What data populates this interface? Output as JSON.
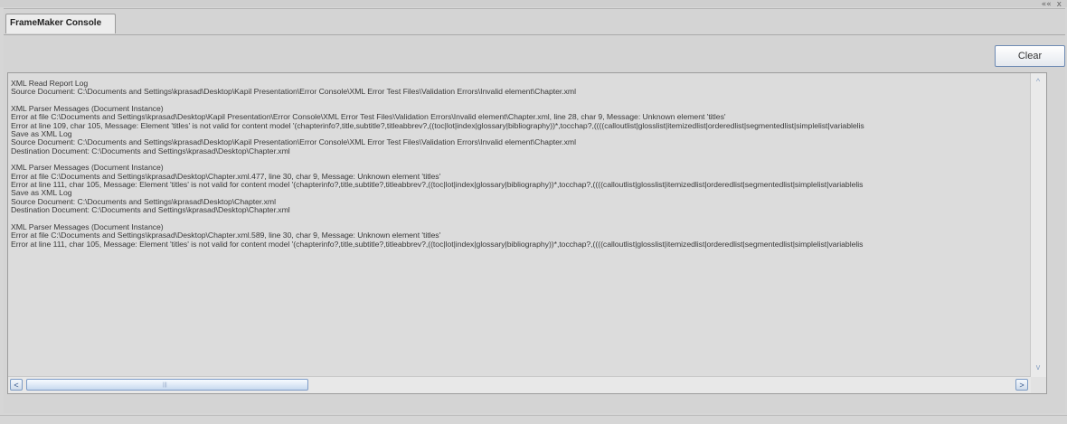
{
  "window": {
    "controls": [
      "««",
      "x"
    ]
  },
  "tabs": [
    {
      "label": "FrameMaker Console",
      "active": true
    }
  ],
  "toolbar": {
    "clear_label": "Clear"
  },
  "console": {
    "lines": [
      "XML Read Report Log",
      "Source Document: C:\\Documents and Settings\\kprasad\\Desktop\\Kapil Presentation\\Error Console\\XML Error Test Files\\Validation Errors\\Invalid element\\Chapter.xml",
      "",
      "XML Parser Messages (Document Instance)",
      "Error at file C:\\Documents and Settings\\kprasad\\Desktop\\Kapil Presentation\\Error Console\\XML Error Test Files\\Validation Errors\\Invalid element\\Chapter.xml, line 28, char 9, Message: Unknown element 'titles'",
      "Error at line 109, char 105, Message: Element 'titles' is not valid for content model '(chapterinfo?,title,subtitle?,titleabbrev?,((toc|lot|index|glossary|bibliography))*,tocchap?,((((calloutlist|glosslist|itemizedlist|orderedlist|segmentedlist|simplelist|variablelis",
      "Save as XML Log",
      "Source Document: C:\\Documents and Settings\\kprasad\\Desktop\\Kapil Presentation\\Error Console\\XML Error Test Files\\Validation Errors\\Invalid element\\Chapter.xml",
      "Destination Document: C:\\Documents and Settings\\kprasad\\Desktop\\Chapter.xml",
      "",
      "XML Parser Messages (Document Instance)",
      "Error at file C:\\Documents and Settings\\kprasad\\Desktop\\Chapter.xml.477, line 30, char 9, Message: Unknown element 'titles'",
      "Error at line 111, char 105, Message: Element 'titles' is not valid for content model '(chapterinfo?,title,subtitle?,titleabbrev?,((toc|lot|index|glossary|bibliography))*,tocchap?,((((calloutlist|glosslist|itemizedlist|orderedlist|segmentedlist|simplelist|variablelis",
      "Save as XML Log",
      "Source Document: C:\\Documents and Settings\\kprasad\\Desktop\\Chapter.xml",
      "Destination Document: C:\\Documents and Settings\\kprasad\\Desktop\\Chapter.xml",
      "",
      "XML Parser Messages (Document Instance)",
      "Error at file C:\\Documents and Settings\\kprasad\\Desktop\\Chapter.xml.589, line 30, char 9, Message: Unknown element 'titles'",
      "Error at line 111, char 105, Message: Element 'titles' is not valid for content model '(chapterinfo?,title,subtitle?,titleabbrev?,((toc|lot|index|glossary|bibliography))*,tocchap?,((((calloutlist|glosslist|itemizedlist|orderedlist|segmentedlist|simplelist|variablelis"
    ]
  },
  "scrollbars": {
    "up_arrow": "^",
    "down_arrow": "v",
    "left_arrow": "<",
    "right_arrow": ">",
    "thumb_grip": "|||"
  },
  "colors": {
    "background": "#d6d6d6",
    "console_bg": "#dcdcdc",
    "text": "#3a3a3a",
    "scroll_accent": "#7c9bc4"
  }
}
